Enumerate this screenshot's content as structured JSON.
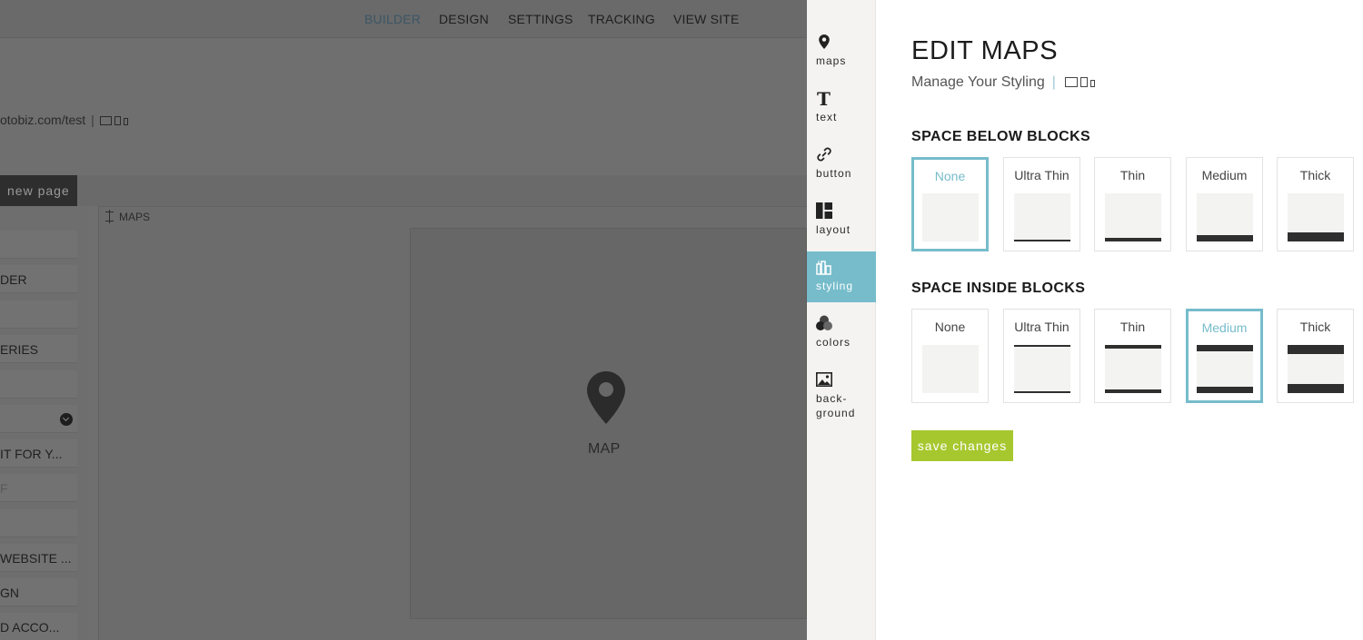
{
  "background_app": {
    "topnav": [
      {
        "label": "BUILDER",
        "active": true
      },
      {
        "label": "DESIGN",
        "active": false
      },
      {
        "label": "SETTINGS",
        "active": false
      },
      {
        "label": "TRACKING",
        "active": false
      },
      {
        "label": "VIEW SITE",
        "active": false
      }
    ],
    "site_url": "otobiz.com/test",
    "url_separator": "|",
    "new_page_button": "new page",
    "sidebar_items": [
      "",
      "DER",
      "",
      "ERIES",
      "",
      "",
      "IT FOR Y...",
      "F",
      "",
      "WEBSITE ...",
      "GN",
      "D ACCO..."
    ],
    "block_label": "MAPS",
    "map_label": "MAP"
  },
  "rail": {
    "items": [
      {
        "label": "maps",
        "icon": "map-pin-icon",
        "active": false
      },
      {
        "label": "text",
        "icon": "text-icon",
        "active": false
      },
      {
        "label": "button",
        "icon": "link-icon",
        "active": false
      },
      {
        "label": "layout",
        "icon": "layout-icon",
        "active": false
      },
      {
        "label": "styling",
        "icon": "styling-icon",
        "active": true
      },
      {
        "label": "colors",
        "icon": "colors-icon",
        "active": false
      },
      {
        "label": "back-\nground",
        "icon": "image-icon",
        "active": false
      }
    ]
  },
  "panel": {
    "title": "EDIT MAPS",
    "subtitle": "Manage Your Styling",
    "subtitle_separator": "|",
    "space_below": {
      "heading": "SPACE BELOW BLOCKS",
      "options": [
        "None",
        "Ultra Thin",
        "Thin",
        "Medium",
        "Thick"
      ],
      "selected": "None"
    },
    "space_inside": {
      "heading": "SPACE INSIDE BLOCKS",
      "options": [
        "None",
        "Ultra Thin",
        "Thin",
        "Medium",
        "Thick"
      ],
      "selected": "Medium"
    },
    "save_label": "save changes"
  },
  "colors": {
    "accent": "#76bccb",
    "save_button": "#a7c72e",
    "rail_bg": "#f4f3f1"
  }
}
